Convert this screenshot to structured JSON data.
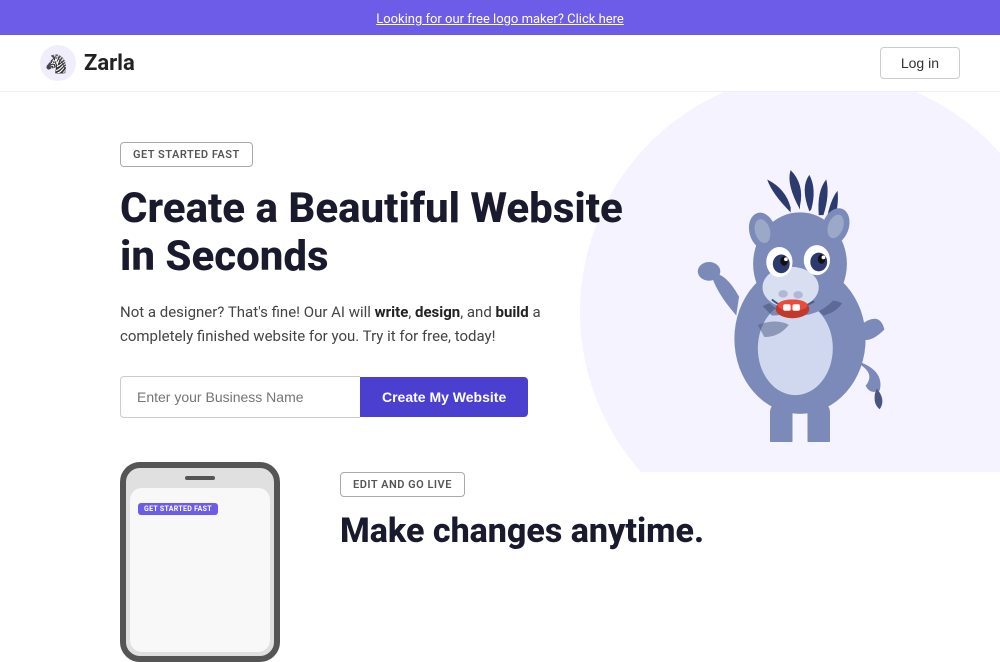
{
  "banner": {
    "text": "Looking for our free logo maker? Click here"
  },
  "nav": {
    "logo_text": "Zarla",
    "login_label": "Log in"
  },
  "hero": {
    "badge": "GET STARTED FAST",
    "title": "Create a Beautiful Website in Seconds",
    "subtitle_pre": "Not a designer? That's fine! Our AI will ",
    "subtitle_bold1": "write",
    "subtitle_mid1": ", ",
    "subtitle_bold2": "design",
    "subtitle_mid2": ", and ",
    "subtitle_bold3": "build",
    "subtitle_post": " a completely finished website for you. Try it for free, today!",
    "input_placeholder": "Enter your Business Name",
    "cta_label": "Create My Website"
  },
  "lower": {
    "badge": "EDIT AND GO LIVE",
    "title": "Make changes anytime.",
    "phone_badge": "GET STARTED FAST"
  }
}
